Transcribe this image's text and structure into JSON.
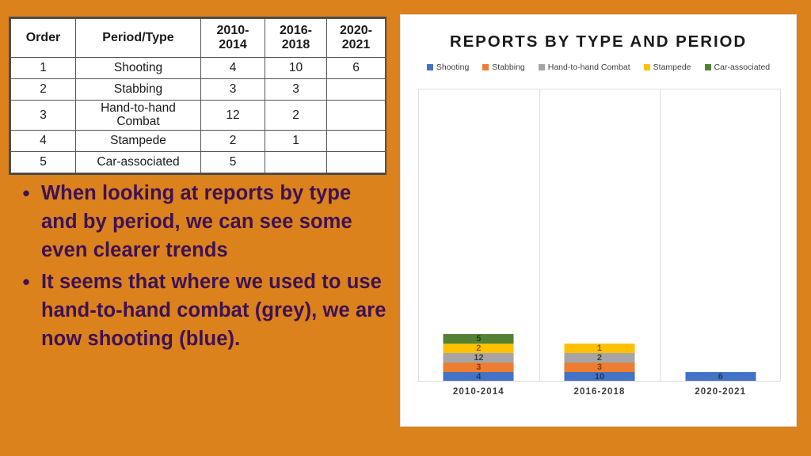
{
  "slide": {
    "background_color": "#DB821C",
    "text_color": "#3E1155"
  },
  "table": {
    "headers": [
      "Order",
      "Period/Type",
      "2010-2014",
      "2016-2018",
      "2020-2021"
    ],
    "header_lines": [
      [
        "Order"
      ],
      [
        "Period/Type"
      ],
      [
        "2010-",
        "2014"
      ],
      [
        "2016-",
        "2018"
      ],
      [
        "2020-",
        "2021"
      ]
    ],
    "rows": [
      {
        "order": "1",
        "type": "Shooting",
        "p1": "4",
        "p2": "10",
        "p3": "6"
      },
      {
        "order": "2",
        "type": "Stabbing",
        "p1": "3",
        "p2": "3",
        "p3": ""
      },
      {
        "order": "3",
        "type": "Hand-to-hand Combat",
        "type_lines": [
          "Hand-to-hand",
          "Combat"
        ],
        "p1": "12",
        "p2": "2",
        "p3": ""
      },
      {
        "order": "4",
        "type": "Stampede",
        "p1": "2",
        "p2": "1",
        "p3": ""
      },
      {
        "order": "5",
        "type": "Car-associated",
        "p1": "5",
        "p2": "",
        "p3": ""
      }
    ]
  },
  "bullets": [
    {
      "marker": "•",
      "text": "When looking at reports by type and by period, we can see some even clearer trends"
    },
    {
      "marker": "•",
      "text": "It seems that where we used to use hand-to-hand combat (grey), we are now shooting (blue)."
    }
  ],
  "chart_data": {
    "type": "bar",
    "subtype": "stacked",
    "title": "REPORTS BY TYPE AND PERIOD",
    "xlabel": "",
    "ylabel": "",
    "grid": false,
    "legend_position": "top",
    "categories": [
      "2010-2014",
      "2016-2018",
      "2020-2021"
    ],
    "ymax": 26,
    "series": [
      {
        "name": "Shooting",
        "color": "#4472C4",
        "label_color": "#1F3864",
        "values": [
          4,
          10,
          6
        ]
      },
      {
        "name": "Stabbing",
        "color": "#ED7D31",
        "label_color": "#833C07",
        "values": [
          3,
          3,
          0
        ]
      },
      {
        "name": "Hand-to-hand Combat",
        "color": "#A5A5A5",
        "label_color": "#3B3B3B",
        "values": [
          12,
          2,
          0
        ]
      },
      {
        "name": "Stampede",
        "color": "#FFC000",
        "label_color": "#7F5F00",
        "values": [
          2,
          1,
          0
        ]
      },
      {
        "name": "Car-associated",
        "color": "#548235",
        "label_color": "#274111",
        "values": [
          5,
          0,
          0
        ]
      }
    ]
  }
}
